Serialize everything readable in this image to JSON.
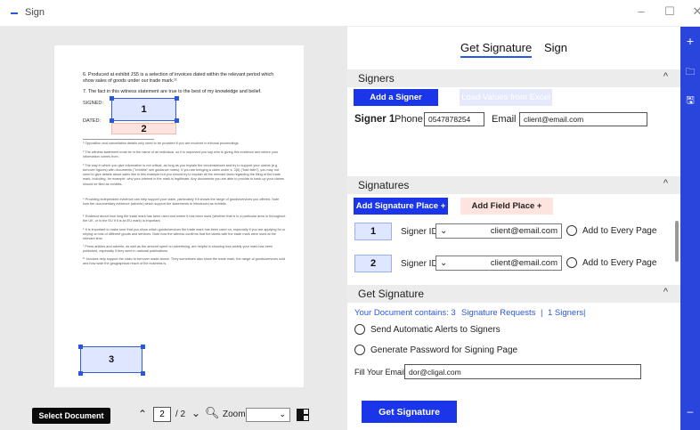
{
  "window": {
    "title": "Sign",
    "controls": [
      "–",
      "☐",
      "✕"
    ]
  },
  "document": {
    "para6": "6. Produced at exhibit JS5 is a selection of invoices dated within the relevant period which show sales of goods under our trade mark.¹¹",
    "para7": "7. The fact in this witness statement are true to the best of my knowledge and belief.",
    "signed_label": "SIGNED:",
    "dated_label": "DATED:",
    "box1": "1",
    "box2": "2",
    "box3": "3",
    "fn1": "¹ Opposition and cancellation details only need to be provided if you are involved in tribunal proceedings.",
    "fn2": "² The witness statement must be in the name of an individual, so it is important you say who is giving this evidence and where your information comes from.",
    "fn3": "³ The way in which you give information is not critical, as long as you explain the circumstances and try to support your claims (e.g. turnover figures) with documents (\"exhibits\" see guidance notes). If you are bringing a claim under s. 3(6) (\"bad faith\"), you may not need to give details about sales like in this example but you should try to explain all the relevant facts regarding the filing of the trade mark, including, for example, why your interest in the mark is legitimate. Any documents you are able to provide to back up your claims should be filed as exhibits.",
    "fn4": "⁴ Providing independent evidence can help support your claim, particularly if it shows the range of goods/services you offered. Note how the documentary evidence (adverts) which support the statements is introduced as exhibits.",
    "fn5": "⁵ Evidence about how long the trade mark has been used and where it has been used (whether that is in a particular area or throughout the UK, or in the EU if it is an EU mark) is important.",
    "fn6": "⁶ It is important to make sure that you show which goods/services the trade mark has been used on, especially if you are applying for or relying on lots of different goods and services. Note how the witness confirms that the labels with the trade mark were used at the relevant time.",
    "fn7": "⁷ Press articles and adverts, as well as the amount spent on advertising, are helpful in showing how widely your mark has been published, especially if they were in national publications.",
    "fn8": "¹¹ Invoices help support the claim to turnover made above. They sometimes also show the trade mark, the range of goods/services sold and how wide the geographical reach of the business is."
  },
  "bottombar": {
    "select_document": "Select Document",
    "prev_icon": "chevron-up-icon",
    "page_current": "2",
    "page_total": "/ 2",
    "next_icon": "chevron-down-icon",
    "zoom_label": "Zoom",
    "zoom_value": ""
  },
  "right": {
    "tab_get_signature": "Get Signature",
    "tab_sign": "Sign",
    "signers_header": "Signers",
    "add_signer": "Add a Signer",
    "load_excel": "Load Values from Excel",
    "signer1_label": "Signer 1",
    "phone_label": "Phone",
    "phone_value": "0547878254",
    "email_label": "Email",
    "email_value": "client@email.com",
    "signatures_header": "Signatures",
    "add_sig_place": "Add Signature Place +",
    "add_field_place": "Add Field Place +",
    "rows": [
      {
        "num": "1",
        "signer_id_label": "Signer ID",
        "signer": "client@email.com",
        "every_page": "Add to Every Page"
      },
      {
        "num": "2",
        "signer_id_label": "Signer ID",
        "signer": "client@email.com",
        "every_page": "Add to Every Page"
      }
    ],
    "get_sig_header": "Get Signature",
    "info_contains": "Your Document contains: 3",
    "info_requests": "Signature Requests",
    "info_sep": "|",
    "info_signers": "1 Signers",
    "info_sep2": "|",
    "opt_alerts": "Send Automatic Alerts to Signers",
    "opt_password": "Generate Password for Signing Page",
    "fill_email_label": "Fill Your Email",
    "fill_email_value": "dor@cligal.com",
    "get_signature_btn": "Get Signature"
  },
  "colors": {
    "accent": "#1a36e8",
    "rail": "#2a45dc",
    "pink": "#fde4de",
    "sig_fill": "#dfe6ff"
  }
}
